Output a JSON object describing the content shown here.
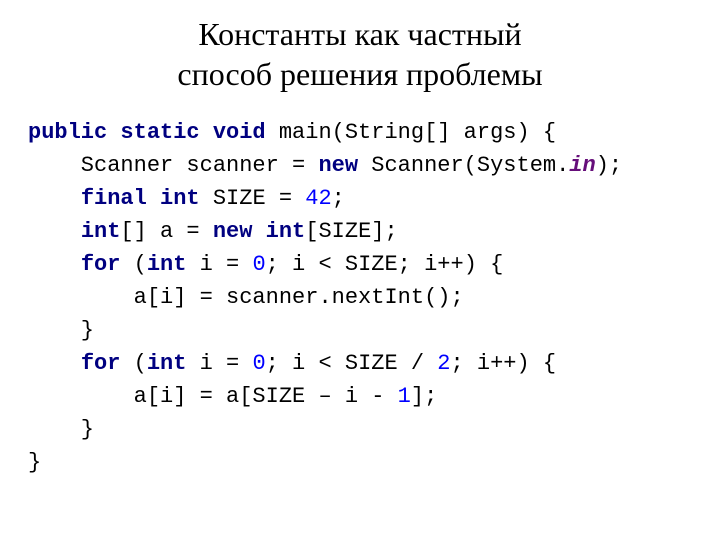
{
  "title_line1": "Константы как частный",
  "title_line2": "способ решения проблемы",
  "code": {
    "l1": {
      "kw1": "public static void",
      "rest": " main(String[] args) {"
    },
    "l2": {
      "p1": "    Scanner scanner = ",
      "kw": "new",
      "p2": " Scanner(System.",
      "sf": "in",
      "p3": ");"
    },
    "l3": {
      "p1": "    ",
      "kw": "final int",
      "p2": " SIZE = ",
      "num": "42",
      "p3": ";"
    },
    "l4": {
      "p1": "    ",
      "kw1": "int",
      "p2": "[] a = ",
      "kw2": "new int",
      "p3": "[SIZE];"
    },
    "l5": {
      "p1": "    ",
      "kw1": "for",
      "p2": " (",
      "kw2": "int",
      "p3": " i = ",
      "num": "0",
      "p4": "; i < SIZE; i++) {"
    },
    "l6": "        a[i] = scanner.nextInt();",
    "l7": "    }",
    "l8": {
      "p1": "    ",
      "kw1": "for",
      "p2": " (",
      "kw2": "int",
      "p3": " i = ",
      "num1": "0",
      "p4": "; i < SIZE / ",
      "num2": "2",
      "p5": "; i++) {"
    },
    "l9": {
      "p1": "        a[i] = a[SIZE – i - ",
      "num": "1",
      "p2": "];"
    },
    "l10": "    }",
    "l11": "}"
  }
}
